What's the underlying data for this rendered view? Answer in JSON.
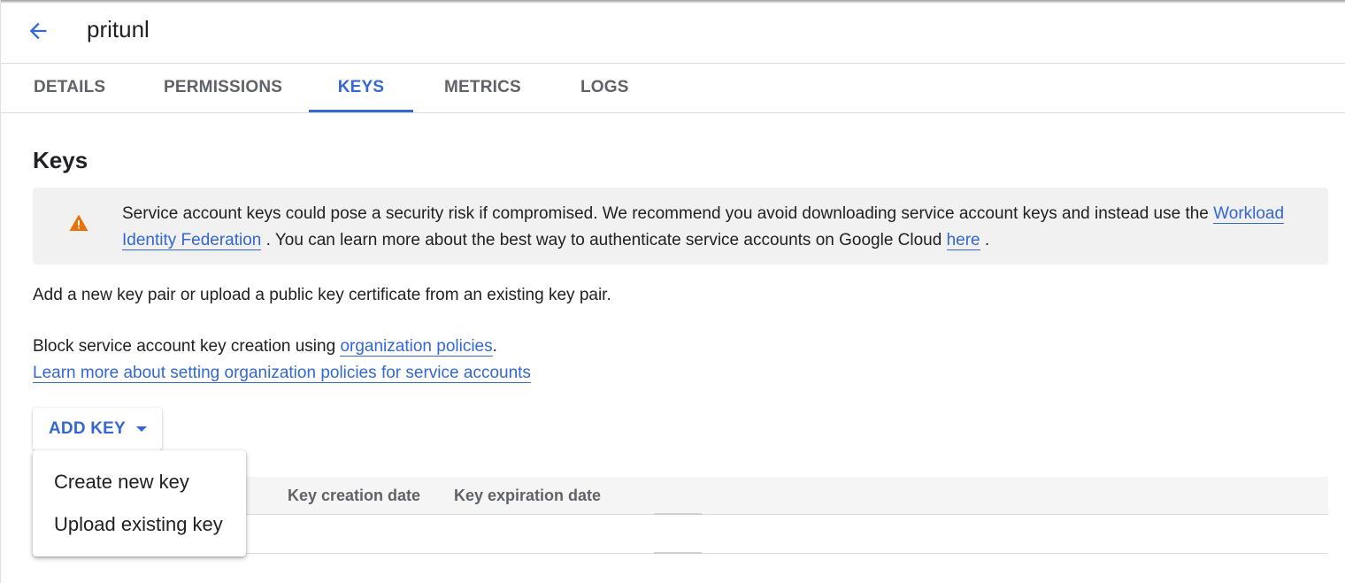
{
  "header": {
    "title": "pritunl",
    "back_icon": "arrow-back-icon"
  },
  "tabs": [
    {
      "label": "DETAILS",
      "active": false
    },
    {
      "label": "PERMISSIONS",
      "active": false
    },
    {
      "label": "KEYS",
      "active": true
    },
    {
      "label": "METRICS",
      "active": false
    },
    {
      "label": "LOGS",
      "active": false
    }
  ],
  "section": {
    "title": "Keys"
  },
  "banner": {
    "icon": "warning-icon",
    "text_1": "Service account keys could pose a security risk if compromised. We recommend you avoid downloading service account keys and instead use the ",
    "link_1": "Workload Identity Federation",
    "text_2": " . You can learn more about the best way to authenticate service accounts on Google Cloud ",
    "link_2": "here",
    "text_3": " ."
  },
  "intro": "Add a new key pair or upload a public key certificate from an existing key pair.",
  "policy": {
    "text": "Block service account key creation using ",
    "link": "organization policies",
    "period": ".",
    "learn_more": "Learn more about setting organization policies for service accounts"
  },
  "add_key": {
    "label": "ADD KEY"
  },
  "menu": {
    "items": [
      "Create new key",
      "Upload existing key"
    ]
  },
  "table": {
    "columns": [
      "Key creation date",
      "Key expiration date"
    ]
  },
  "colors": {
    "accent": "#3367d6",
    "warning": "#e8710a",
    "banner_bg": "#f1f1f1"
  }
}
